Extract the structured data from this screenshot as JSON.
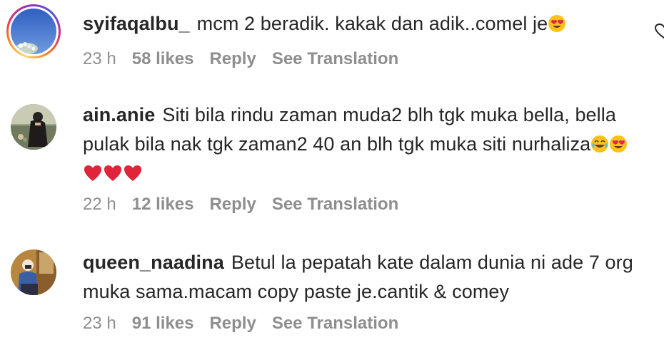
{
  "comments": [
    {
      "username": "syifaqalbu_",
      "text": "mcm 2 beradik. kakak dan adik..comel je",
      "emojis": [
        "heart-eyes"
      ],
      "time": "23 h",
      "likes": "58 likes",
      "reply": "Reply",
      "translate": "See Translation",
      "has_story": true
    },
    {
      "username": "ain.anie",
      "text": "Siti bila rindu zaman muda2 blh tgk muka bella, bella pulak bila nak tgk zaman2 40 an blh tgk muka siti nurhaliza",
      "emojis": [
        "joy",
        "heart-eyes",
        "red-heart",
        "red-heart",
        "red-heart"
      ],
      "time": "22 h",
      "likes": "12 likes",
      "reply": "Reply",
      "translate": "See Translation",
      "has_story": false
    },
    {
      "username": "queen_naadina",
      "text": "Betul la pepatah kate dalam dunia ni ade 7 org muka sama.macam copy paste je.cantik & comey",
      "emojis": [],
      "time": "23 h",
      "likes": "91 likes",
      "reply": "Reply",
      "translate": "See Translation",
      "has_story": false
    }
  ],
  "colors": {
    "text": "#262626",
    "meta": "#8e8e8e",
    "story_ring": [
      "#feda75",
      "#fa7e1e",
      "#d62976",
      "#962fbf",
      "#4f5bd5"
    ]
  }
}
